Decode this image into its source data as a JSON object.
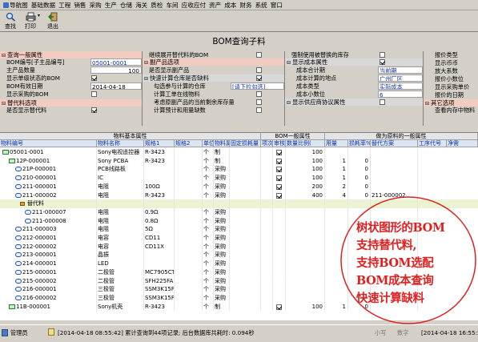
{
  "menu": [
    "导航图",
    "基础数据",
    "工程",
    "销售",
    "采购",
    "生产",
    "仓储",
    "海关",
    "质检",
    "车间",
    "应收应付",
    "资产",
    "成本",
    "财务",
    "系统",
    "窗口"
  ],
  "toolbar": {
    "find": "查找",
    "print": "打印",
    "exit": "退出"
  },
  "title": "BOM查询子料",
  "panel1": {
    "header": "查询一般属性",
    "bom_code_label": "BOM编号[子主品编号]",
    "bom_code": "05001-0001",
    "main_qty_label": "主产品数量",
    "main_qty": "100",
    "show_single_label": "显示单级状态的BOM",
    "valid_date_label": "BOM有效日期",
    "valid_date": "2014-04-18",
    "show_subst_label": "显示采购的BOM",
    "subst_header": "替代料选项",
    "show_subst2_label": "是否显示替代料"
  },
  "panel2": {
    "expand_label": "继续展开替代料的BOM",
    "sub_header": "副产品选项",
    "show_sub_label": "是否显示副产品",
    "fast_calc_label": "快速计算仓库是否缺料",
    "calc_stock_label": "勾选参与计算的仓库",
    "calc_stock": "[请下拉勾选]",
    "calc_work_label": "计算工单在线物料",
    "consider_label": "考虑原副产品的当前剩余库存量",
    "calc_expected_label": "计算预计和用量缺数"
  },
  "panel3": {
    "use_replace_label": "强制使用被替换的库存",
    "cost_header": "显示成本属性",
    "cost_calc_label": "成本合计期",
    "cost_calc": "当前期",
    "cost_place_label": "成本计算的地点",
    "cost_place": "广州厂区",
    "cost_type_label": "成本类型",
    "cost_type": "实际成本",
    "cost_decimal_label": "成本小数位",
    "cost_decimal": "6",
    "other_header": "显示供应商协议属性"
  },
  "panel4": {
    "a": "报价类型",
    "b": "显示币币",
    "c": "放大系数",
    "d": "报价小数位",
    "e": "显示采购单价",
    "f": "报价的日期",
    "g": "其它选项",
    "h": "查看内存中物料"
  },
  "grid_headers": {
    "g1": "物料基本属性",
    "g2": "BOM一般属性",
    "g3": "做为原料的一般属性",
    "cols": [
      "物料编号",
      "物料名称",
      "规格1",
      "规格2",
      "单位",
      "物料属性",
      "固定损耗量",
      "项次",
      "审核",
      "数量比例(",
      "用量",
      "损耗率%",
      "替代方案",
      "工序代号",
      "净需"
    ]
  },
  "rows": [
    {
      "code": "05001-0001",
      "name": "Sony电视遥控器",
      "spec": "R-3423",
      "unit": "个",
      "attr": "制",
      "audit": "",
      "qty": "100",
      "use": "",
      "loss": ""
    },
    {
      "code": "12P-000001",
      "name": "Sony PCBA",
      "spec": "R-3423",
      "unit": "个",
      "attr": "制",
      "audit": "",
      "qty": "100",
      "use": "1",
      "loss": "0"
    },
    {
      "code": "21P-000001",
      "name": "PCB线路板",
      "spec": "",
      "unit": "个",
      "attr": "采购",
      "audit": "",
      "qty": "100",
      "use": "1",
      "loss": "0"
    },
    {
      "code": "210-000001",
      "name": "IC",
      "spec": "",
      "unit": "个",
      "attr": "采购",
      "audit": "",
      "qty": "100",
      "use": "1",
      "loss": "0"
    },
    {
      "code": "211-000001",
      "name": "电阻",
      "spec": "100Ω",
      "unit": "个",
      "attr": "采购",
      "audit": "",
      "qty": "200",
      "use": "2",
      "loss": "0"
    },
    {
      "code": "211-000002",
      "name": "电阻",
      "spec": "R-3423",
      "unit": "个",
      "attr": "采购",
      "audit": "",
      "qty": "400",
      "use": "4",
      "loss": "0",
      "subst": "211-000002"
    },
    {
      "code": "替代料",
      "name": "",
      "spec": "",
      "unit": "",
      "attr": "",
      "audit": "",
      "qty": "",
      "use": "",
      "loss": ""
    },
    {
      "code": "211-000007",
      "name": "电阻",
      "spec": "0.9Ω",
      "unit": "个",
      "attr": "采购",
      "audit": "",
      "qty": "",
      "use": "",
      "loss": ""
    },
    {
      "code": "211-000008",
      "name": "电阻",
      "spec": "0.8Ω",
      "unit": "个",
      "attr": "采购",
      "audit": "",
      "qty": "",
      "use": "",
      "loss": ""
    },
    {
      "code": "211-000003",
      "name": "电阻",
      "spec": "5Ω",
      "unit": "个",
      "attr": "采购",
      "audit": "",
      "qty": "",
      "use": "",
      "loss": ""
    },
    {
      "code": "212-000001",
      "name": "电容",
      "spec": "CD11",
      "unit": "个",
      "attr": "采购",
      "audit": "",
      "qty": "",
      "use": "",
      "loss": ""
    },
    {
      "code": "212-000002",
      "name": "电容",
      "spec": "CD11X",
      "unit": "个",
      "attr": "采购",
      "audit": "",
      "qty": "",
      "use": "",
      "loss": ""
    },
    {
      "code": "213-000001",
      "name": "晶振",
      "spec": "",
      "unit": "个",
      "attr": "采购",
      "audit": "",
      "qty": "",
      "use": "",
      "loss": ""
    },
    {
      "code": "214-000001",
      "name": "LED",
      "spec": "",
      "unit": "个",
      "attr": "采购",
      "audit": "",
      "qty": "",
      "use": "",
      "loss": ""
    },
    {
      "code": "215-000001",
      "name": "二极管",
      "spec": "MC7905CT",
      "unit": "个",
      "attr": "采购",
      "audit": "",
      "qty": "",
      "use": "",
      "loss": ""
    },
    {
      "code": "215-000002",
      "name": "二极管",
      "spec": "SFH225FA",
      "unit": "个",
      "attr": "采购",
      "audit": "",
      "qty": "",
      "use": "",
      "loss": ""
    },
    {
      "code": "216-000001",
      "name": "三极管",
      "spec": "SSM3K15FS",
      "unit": "个",
      "attr": "采购",
      "audit": "",
      "qty": "",
      "use": "",
      "loss": ""
    },
    {
      "code": "216-000002",
      "name": "三极管",
      "spec": "SSM3K15FS",
      "unit": "个",
      "attr": "采购",
      "audit": "",
      "qty": "",
      "use": "",
      "loss": ""
    },
    {
      "code": "11B-000001",
      "name": "Sony机壳",
      "spec": "R-3423",
      "unit": "个",
      "attr": "制",
      "audit": "",
      "qty": "100",
      "use": "1",
      "loss": "0"
    }
  ],
  "overlay": {
    "l1": "树状图形的BOM",
    "l2": "支持替代料,",
    "l3": "支持BOM选配",
    "l4": "BOM成本查询",
    "l5": "快速计算缺料"
  },
  "status": {
    "user": "管理员",
    "log": "[2014-04-18 08:55:42] 累计查询到44项记录; 后台数据库共耗时: 0.094秒",
    "caps": "小写",
    "num": "数字",
    "time": "[2014-04-18 16:55:52]"
  }
}
